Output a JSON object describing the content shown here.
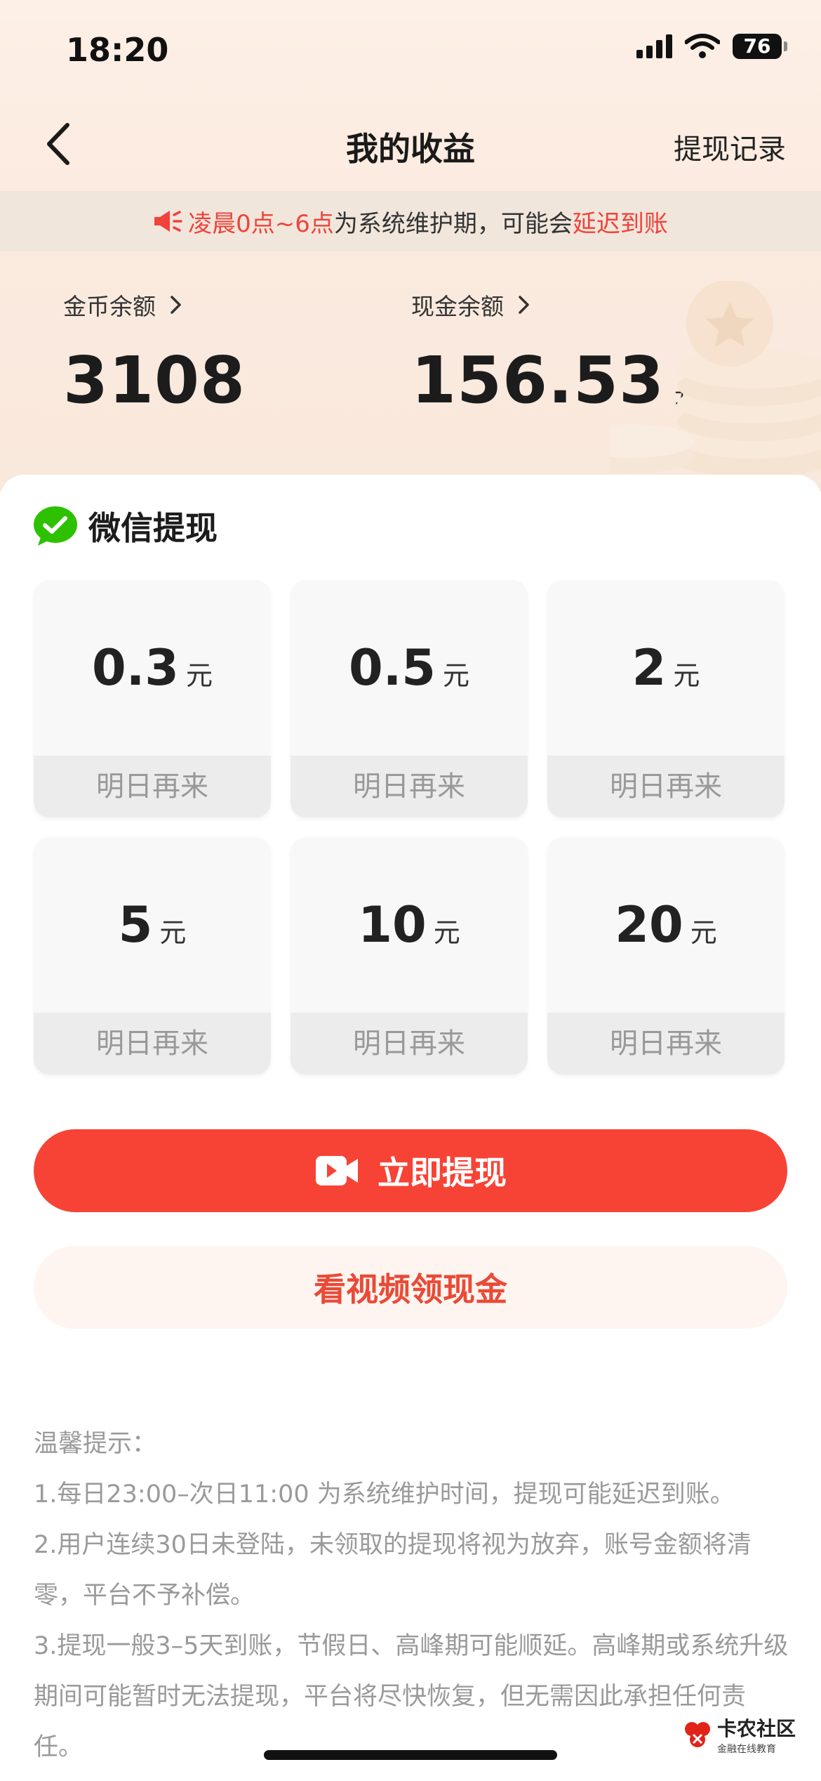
{
  "status_bar": {
    "time": "18:20",
    "battery": "76"
  },
  "nav": {
    "title": "我的收益",
    "history_link": "提现记录"
  },
  "notice": {
    "part1": "凌晨0点~6点",
    "part2": "为系统维护期，可能会",
    "part3": "延迟到账"
  },
  "balances": {
    "coin": {
      "label": "金币余额",
      "value": "3108"
    },
    "cash": {
      "label": "现金余额",
      "value": "156.53",
      "unit": "元"
    }
  },
  "withdraw": {
    "method_label": "微信提现",
    "options": [
      {
        "amount": "0.3",
        "unit": "元",
        "status": "明日再来"
      },
      {
        "amount": "0.5",
        "unit": "元",
        "status": "明日再来"
      },
      {
        "amount": "2",
        "unit": "元",
        "status": "明日再来"
      },
      {
        "amount": "5",
        "unit": "元",
        "status": "明日再来"
      },
      {
        "amount": "10",
        "unit": "元",
        "status": "明日再来"
      },
      {
        "amount": "20",
        "unit": "元",
        "status": "明日再来"
      }
    ]
  },
  "buttons": {
    "withdraw_now": "立即提现",
    "watch_video": "看视频领现金"
  },
  "tips": {
    "title": "温馨提示：",
    "lines": [
      "1.每日23:00–次日11:00 为系统维护时间，提现可能延迟到账。",
      "2.用户连续30日未登陆，未领取的提现将视为放弃，账号金额将清零，平台不予补偿。",
      "3.提现一般3–5天到账，节假日、高峰期可能顺延。高峰期或系统升级期间可能暂时无法提现，平台将尽快恢复，但无需因此承担任何责任。"
    ]
  },
  "watermark": {
    "title": "卡农社区",
    "subtitle": "金融在线教育"
  },
  "colors": {
    "accent": "#f74335",
    "notice_red": "#f0433a",
    "wechat_green": "#2dc100"
  }
}
